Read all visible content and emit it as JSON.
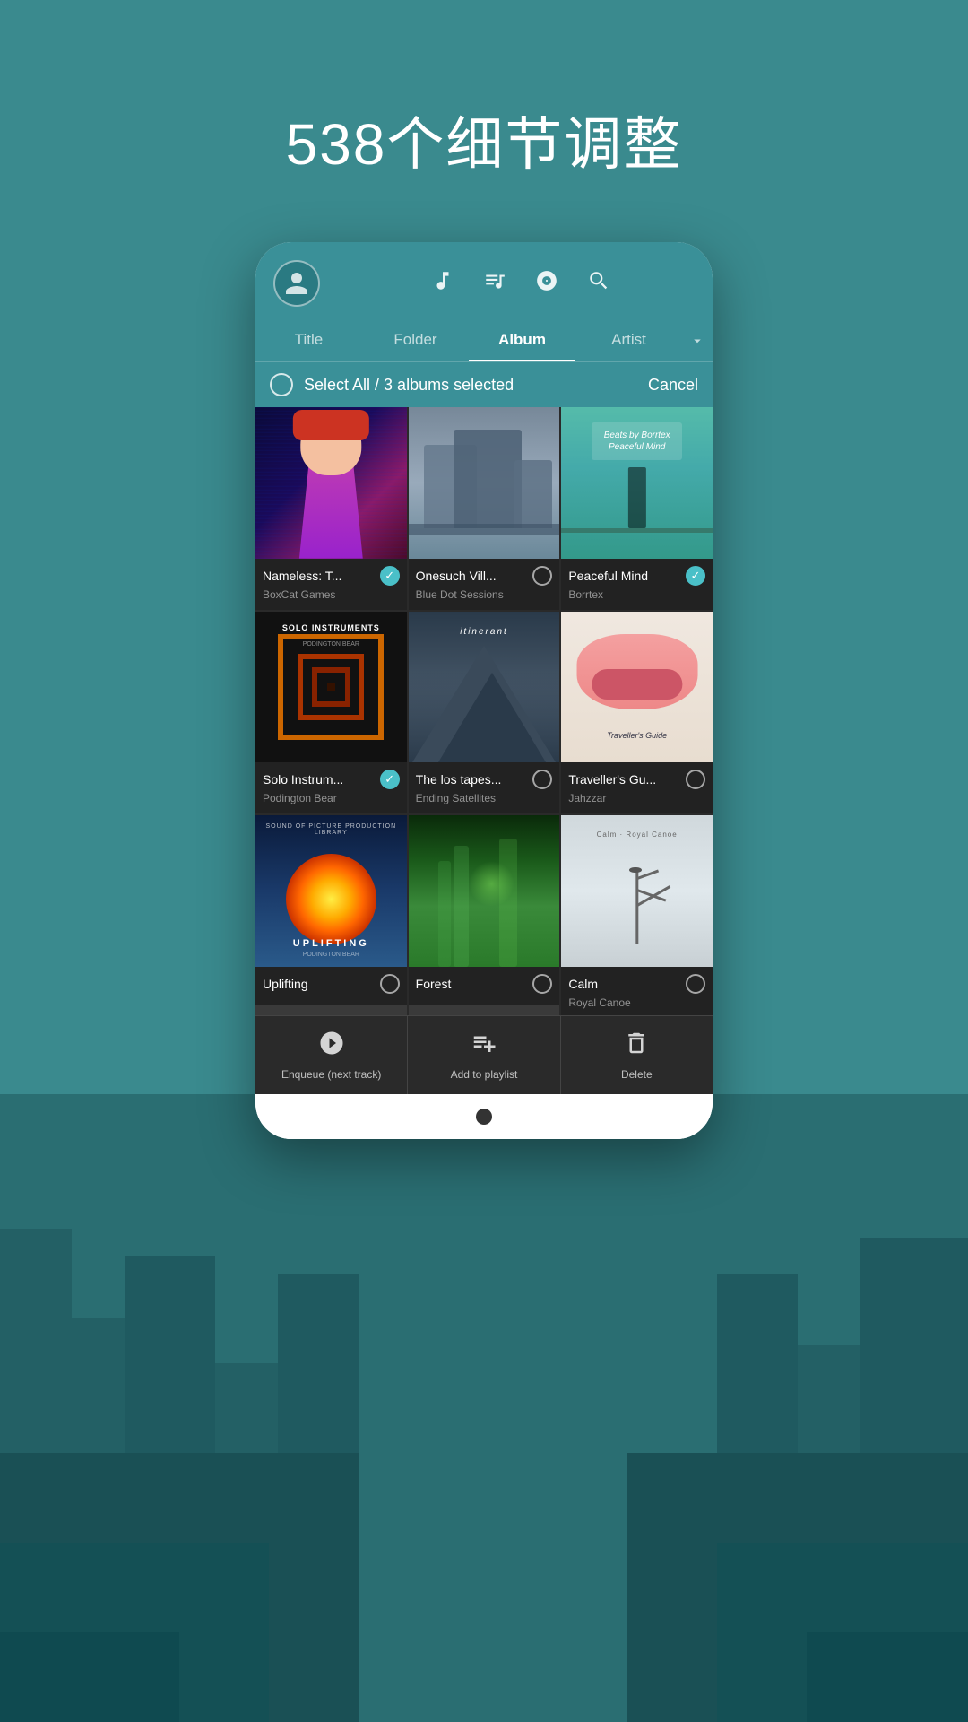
{
  "page": {
    "title": "538个细节调整",
    "bg_color": "#3a8a8e"
  },
  "nav": {
    "avatar_label": "User Avatar",
    "icons": [
      {
        "name": "music-note-icon",
        "symbol": "♪"
      },
      {
        "name": "playlist-icon",
        "symbol": "≡♪"
      },
      {
        "name": "disc-icon",
        "symbol": "◎"
      },
      {
        "name": "search-icon",
        "symbol": "🔍"
      }
    ]
  },
  "tabs": [
    {
      "label": "Title",
      "active": false
    },
    {
      "label": "Folder",
      "active": false
    },
    {
      "label": "Album",
      "active": true
    },
    {
      "label": "Artist",
      "active": false
    }
  ],
  "selection": {
    "circle_label": "Select circle",
    "text": "Select All / 3 albums selected",
    "cancel_label": "Cancel"
  },
  "albums": [
    {
      "name": "Nameless: T...",
      "artist": "BoxCat Games",
      "checked": true,
      "cover_class": "cover-nameless"
    },
    {
      "name": "Onesuch Vill...",
      "artist": "Blue Dot Sessions",
      "checked": false,
      "cover_class": "cover-onesuch"
    },
    {
      "name": "Peaceful Mind",
      "artist": "Borrtex",
      "checked": true,
      "cover_class": "cover-peaceful"
    },
    {
      "name": "Solo Instrum...",
      "artist": "Podington Bear",
      "checked": true,
      "cover_class": "cover-solo"
    },
    {
      "name": "The los tapes...",
      "artist": "Ending Satellites",
      "checked": false,
      "cover_class": "cover-tapes"
    },
    {
      "name": "Traveller's Gu...",
      "artist": "Jahzzar",
      "checked": false,
      "cover_class": "cover-traveller"
    },
    {
      "name": "Uplifting",
      "artist": "",
      "checked": false,
      "cover_class": "cover-uplifting"
    },
    {
      "name": "Forest",
      "artist": "",
      "checked": false,
      "cover_class": "cover-green"
    },
    {
      "name": "Calm",
      "artist": "Royal Canoe",
      "checked": false,
      "cover_class": "cover-grey"
    }
  ],
  "actions": [
    {
      "label": "Enqueue (next track)",
      "icon": "enqueue-icon"
    },
    {
      "label": "Add to playlist",
      "icon": "add-playlist-icon"
    },
    {
      "label": "Delete",
      "icon": "delete-icon"
    }
  ]
}
